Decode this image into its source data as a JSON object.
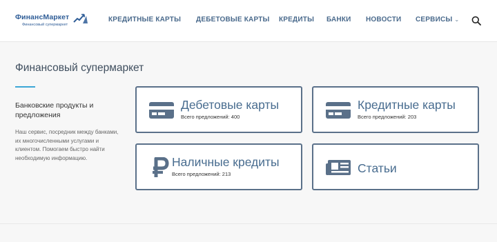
{
  "header": {
    "logo": {
      "title": "ФинансМаркет",
      "subtitle": "Финансовый супермаркет"
    },
    "nav": [
      {
        "label": "КРЕДИТНЫЕ КАРТЫ"
      },
      {
        "label": "ДЕБЕТОВЫЕ КАРТЫ"
      },
      {
        "label": "КРЕДИТЫ"
      },
      {
        "label": "БАНКИ"
      },
      {
        "label": "НОВОСТИ"
      },
      {
        "label": "СЕРВИСЫ",
        "has_dropdown": true
      }
    ],
    "search_icon": "search-icon"
  },
  "main": {
    "title": "Финансовый супермаркет",
    "accent_color": "#3aa6d6",
    "sidebar": {
      "title": "Банковские продукты и предложения",
      "text": "Наш сервис, посредник между банками, их многочисленными услугами и клиентом. Помогаем быстро найти необходимую информацию."
    },
    "cards": [
      {
        "title": "Дебетовые карты",
        "subtitle": "Всего предложений: 400",
        "icon": "card-icon"
      },
      {
        "title": "Кредитные карты",
        "subtitle": "Всего предложений: 203",
        "icon": "card-icon"
      },
      {
        "title": "Наличные кредиты",
        "subtitle": "Всего предложений: 213",
        "icon": "ruble-icon"
      },
      {
        "title": "Статьи",
        "subtitle": "",
        "icon": "newspaper-icon"
      }
    ]
  },
  "colors": {
    "brand": "#2f5d97",
    "card_border": "#5a7089",
    "card_title": "#486c8f",
    "icon": "#5a7089"
  }
}
